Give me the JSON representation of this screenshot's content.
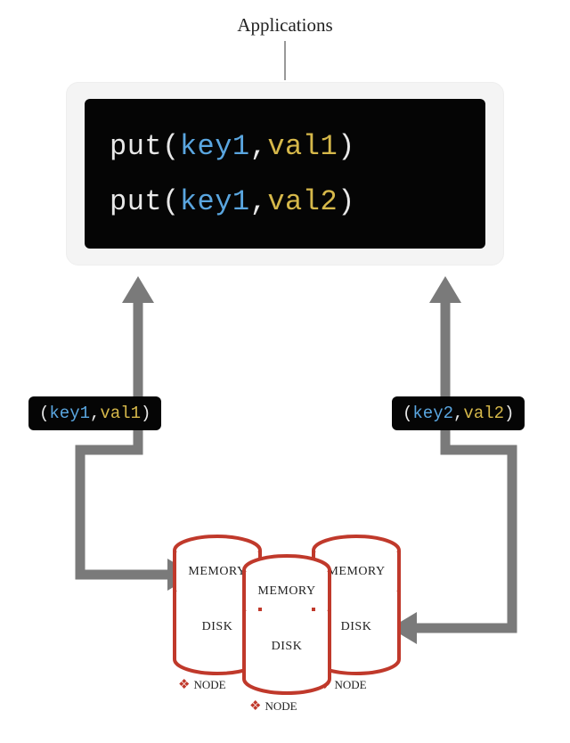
{
  "title": "Applications",
  "code": {
    "line1": {
      "fn": "put",
      "key": "key1",
      "val": "val1"
    },
    "line2": {
      "fn": "put",
      "key": "key1",
      "val": "val2"
    }
  },
  "tuples": {
    "left": {
      "key": "key1",
      "val": "val1"
    },
    "right": {
      "key": "key2",
      "val": "val2"
    }
  },
  "cylinder": {
    "memory": "MEMORY",
    "disk": "DISK"
  },
  "node_label": "NODE"
}
